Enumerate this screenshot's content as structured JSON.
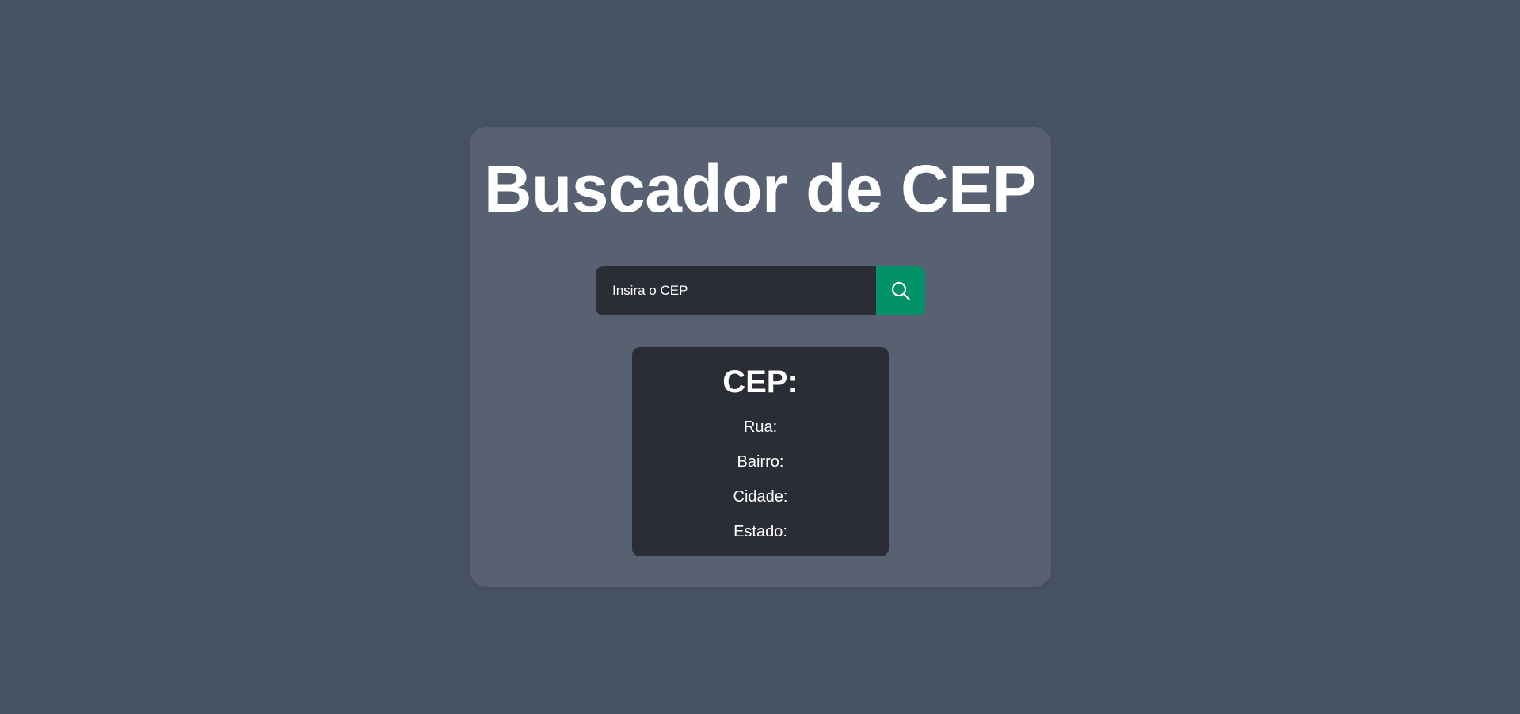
{
  "app": {
    "title": "Buscador de CEP"
  },
  "search": {
    "placeholder": "Insira o CEP",
    "value": "",
    "button_icon": "search-icon"
  },
  "result": {
    "cep_label": "CEP:",
    "street_label": "Rua:",
    "neighborhood_label": "Bairro:",
    "city_label": "Cidade:",
    "state_label": "Estado:"
  },
  "colors": {
    "page_background": "#465163",
    "card_background": "#576171",
    "panel_background": "#2a2d35",
    "accent": "#019267",
    "text": "#ffffff"
  }
}
